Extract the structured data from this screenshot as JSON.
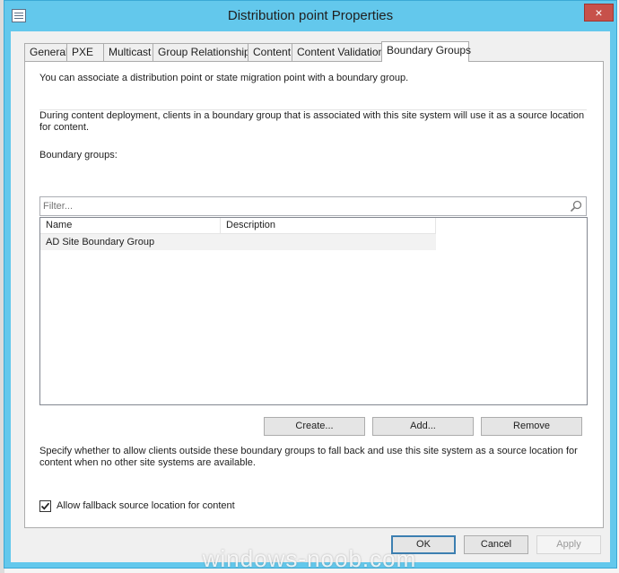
{
  "window": {
    "title": "Distribution point Properties",
    "close_label": "×"
  },
  "tabs": [
    {
      "label": "General"
    },
    {
      "label": "PXE"
    },
    {
      "label": "Multicast"
    },
    {
      "label": "Group Relationships"
    },
    {
      "label": "Content"
    },
    {
      "label": "Content Validation"
    },
    {
      "label": "Boundary Groups",
      "active": true
    }
  ],
  "panel": {
    "intro": "You can associate a distribution point or state migration point with a boundary group.",
    "description": "During content deployment, clients in a boundary group that is associated with this site system will use it as a source location for content.",
    "groups_label": "Boundary groups:",
    "filter_placeholder": "Filter...",
    "columns": [
      "Name",
      "Description"
    ],
    "rows": [
      {
        "name": "AD Site Boundary Group",
        "description": ""
      }
    ],
    "create_label": "Create...",
    "add_label": "Add...",
    "remove_label": "Remove",
    "fallback_text": "Specify whether to allow clients outside these boundary groups to fall back and use this site system as a source location for content when no other site systems are available.",
    "fallback_checkbox_label": "Allow fallback source location for content",
    "fallback_checked": true
  },
  "footer": {
    "ok_label": "OK",
    "cancel_label": "Cancel",
    "apply_label": "Apply"
  },
  "watermark": "windows-noob.com",
  "colors": {
    "titlebar": "#63c8ec",
    "close_button": "#c7514a"
  }
}
